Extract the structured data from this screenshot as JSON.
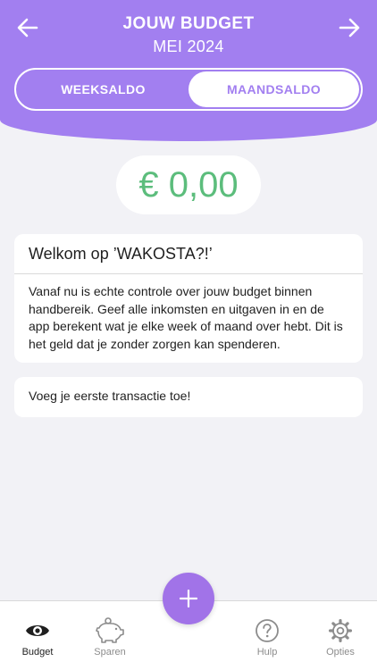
{
  "header": {
    "title": "JOUW BUDGET",
    "subtitle": "MEI 2024",
    "segments": [
      "WEEKSALDO",
      "MAANDSALDO"
    ],
    "active_segment": "MAANDSALDO"
  },
  "balance": "€ 0,00",
  "welcome_card": {
    "title": "Welkom op ’WAKOSTA?!’",
    "body": "Vanaf nu is echte controle over jouw budget binnen handbereik. Geef alle inkomsten en uitgaven in en de app berekent wat je elke week of maand over hebt. Dit is het geld dat je zonder zorgen kan spenderen."
  },
  "first_transaction_card": {
    "text": "Voeg je eerste transactie toe!"
  },
  "tabbar": {
    "items": [
      {
        "label": "Budget",
        "icon": "eye-icon",
        "active": true
      },
      {
        "label": "Sparen",
        "icon": "piggy-bank-icon",
        "active": false
      },
      {
        "label": "Hulp",
        "icon": "help-icon",
        "active": false
      },
      {
        "label": "Opties",
        "icon": "gear-icon",
        "active": false
      }
    ],
    "fab_icon": "plus-icon"
  },
  "colors": {
    "accent": "#a27ff0",
    "fab": "#a173e8",
    "balance_green": "#5cbd7c",
    "background": "#f2f2f6"
  }
}
